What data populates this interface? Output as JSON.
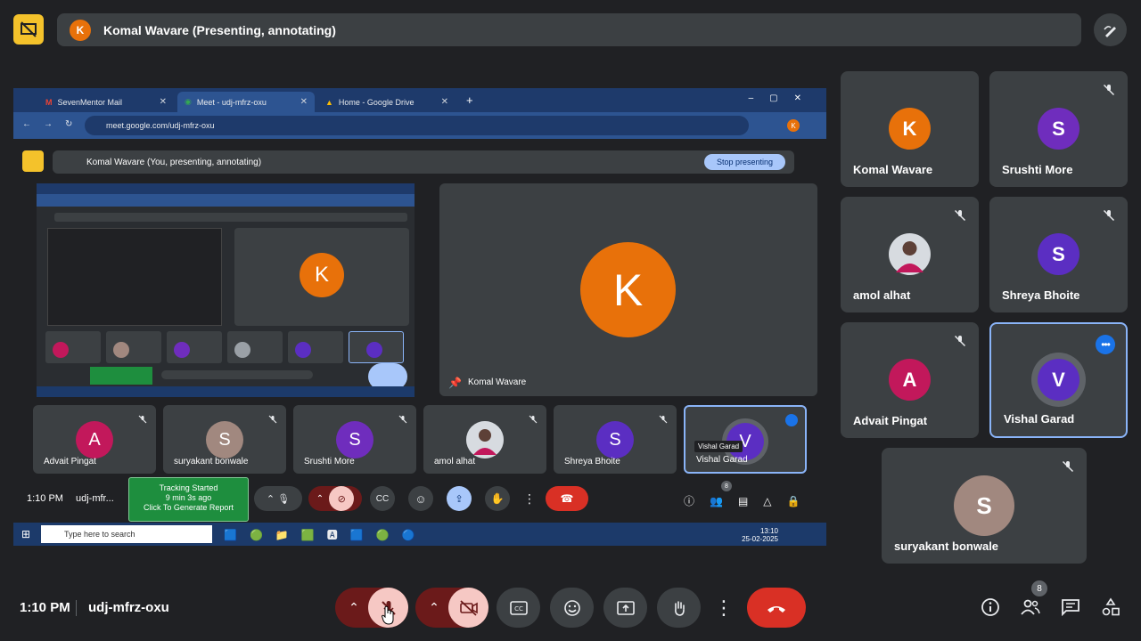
{
  "top_bar": {
    "avatar_letter": "K",
    "title": "Komal Wavare (Presenting, annotating)"
  },
  "right_tiles": [
    {
      "name": "Komal Wavare",
      "letter": "K",
      "color": "#e8710a",
      "muted": false
    },
    {
      "name": "Srushti More",
      "letter": "S",
      "color": "#6f2dbd",
      "muted": true
    },
    {
      "name": "amol alhat",
      "letter": "",
      "color": "#9aa0a6",
      "muted": true,
      "photo": true
    },
    {
      "name": "Shreya Bhoite",
      "letter": "S",
      "color": "#5b2ec2",
      "muted": true
    },
    {
      "name": "Advait Pingat",
      "letter": "A",
      "color": "#c2185b",
      "muted": true
    },
    {
      "name": "Vishal Garad",
      "letter": "V",
      "color": "#5b2ec2",
      "muted": false,
      "active": true
    },
    {
      "name": "suryakant bonwale",
      "letter": "S",
      "color": "#a1887f",
      "muted": true
    }
  ],
  "shared": {
    "tabs": [
      {
        "label": "SevenMentor Mail"
      },
      {
        "label": "Meet - udj-mfrz-oxu"
      },
      {
        "label": "Home - Google Drive"
      }
    ],
    "url": "meet.google.com/udj-mfrz-oxu",
    "presenting_text": "Komal Wavare (You, presenting, annotating)",
    "stop_label": "Stop presenting",
    "main_tile": {
      "letter": "K",
      "name": "Komal Wavare"
    },
    "tiles": [
      {
        "name": "Advait Pingat",
        "letter": "A",
        "color": "#c2185b"
      },
      {
        "name": "suryakant bonwale",
        "letter": "S",
        "color": "#a1887f"
      },
      {
        "name": "Srushti More",
        "letter": "S",
        "color": "#6f2dbd"
      },
      {
        "name": "amol alhat",
        "letter": "",
        "color": "#9aa0a6"
      },
      {
        "name": "Shreya Bhoite",
        "letter": "S",
        "color": "#5b2ec2"
      },
      {
        "name": "Vishal Garad",
        "letter": "V",
        "color": "#5b2ec2"
      }
    ],
    "tooltip": "Vishal Garad",
    "time": "1:10 PM",
    "code": "udj-mfr...",
    "tracking": {
      "line1": "Tracking Started",
      "line2": "9 min 3s ago",
      "line3": "Click To Generate Report"
    },
    "people_count": "8",
    "taskbar_search": "Type here to search",
    "tray_time": "13:10",
    "tray_date": "25-02-2025"
  },
  "bottom": {
    "time": "1:10 PM",
    "code": "udj-mfrz-oxu",
    "people_count": "8"
  },
  "colors": {
    "accent": "#8ab4f8",
    "end_call": "#d93025",
    "background": "#202124",
    "tile": "#3c4043"
  }
}
